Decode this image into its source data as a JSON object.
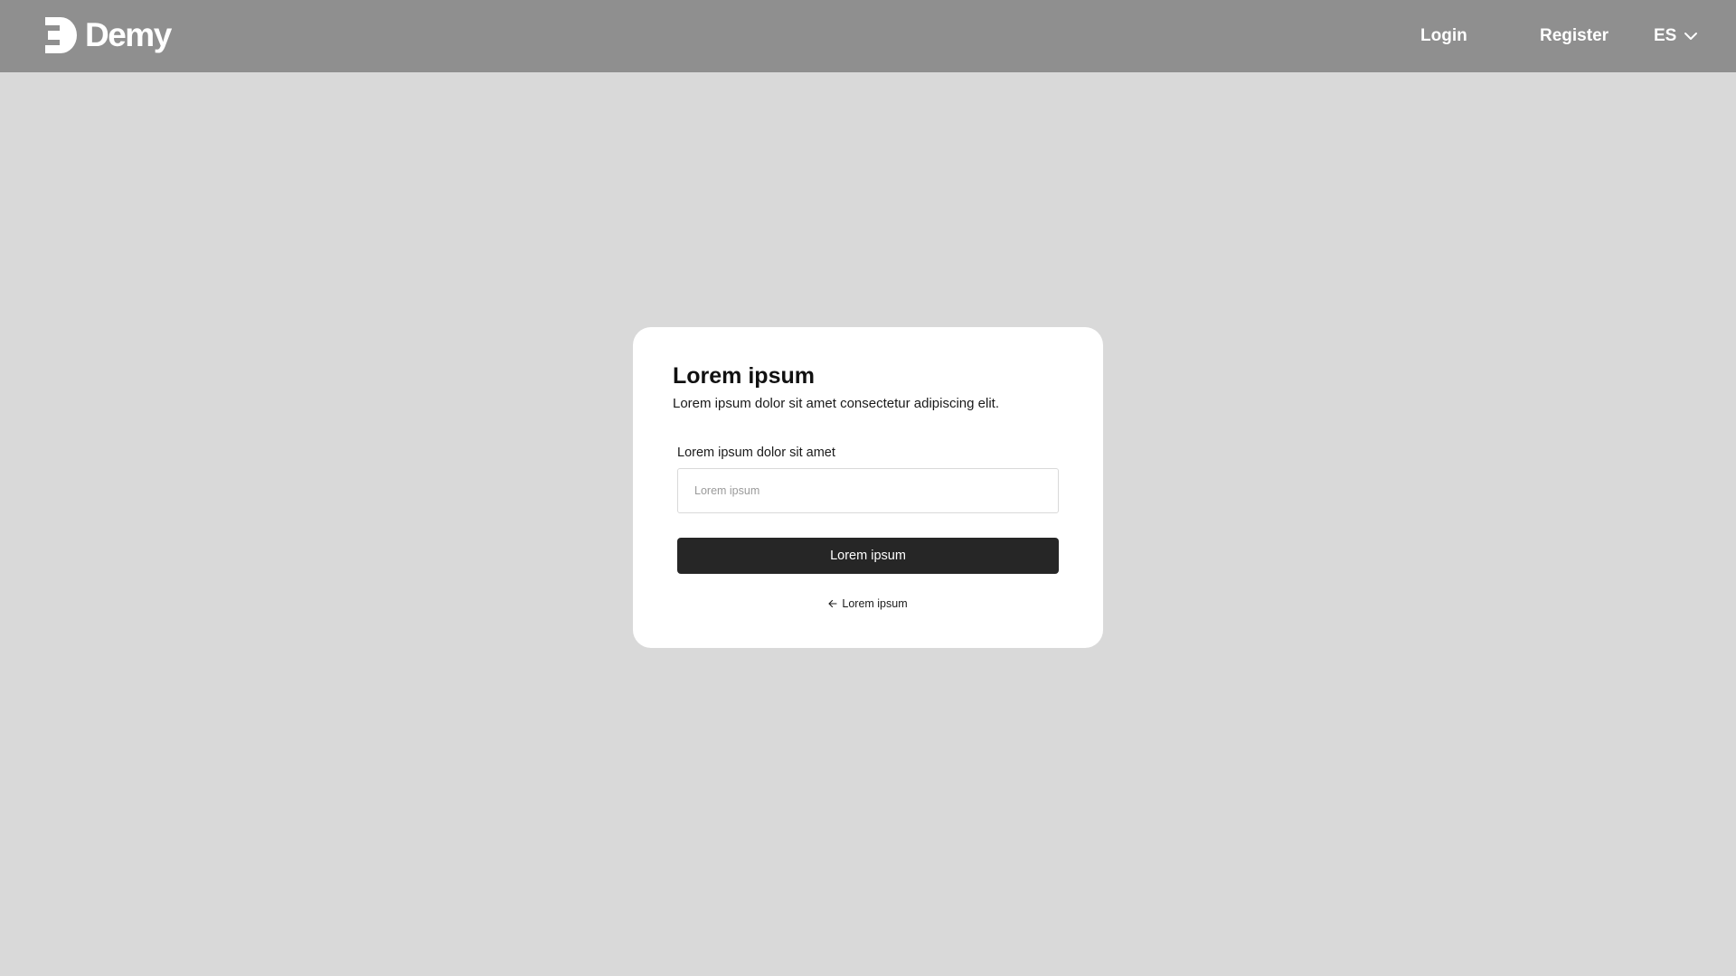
{
  "header": {
    "brand": "Demy",
    "nav": {
      "login_label": "Login",
      "register_label": "Register"
    },
    "language": {
      "selected": "ES",
      "icon": "chevron-down-icon"
    },
    "background_color": "#8f8f8f"
  },
  "page": {
    "background_color": "#d9d9d9"
  },
  "card": {
    "title": "Lorem ipsum",
    "subtitle": "Lorem ipsum dolor sit amet consectetur adipiscing elit.",
    "field": {
      "label": "Lorem ipsum dolor sit amet",
      "value": "",
      "placeholder": "Lorem ipsum"
    },
    "submit_label": "Lorem ipsum",
    "back_link": {
      "icon": "arrow-left-icon",
      "label": "Lorem ipsum"
    },
    "button_color": "#262626"
  }
}
